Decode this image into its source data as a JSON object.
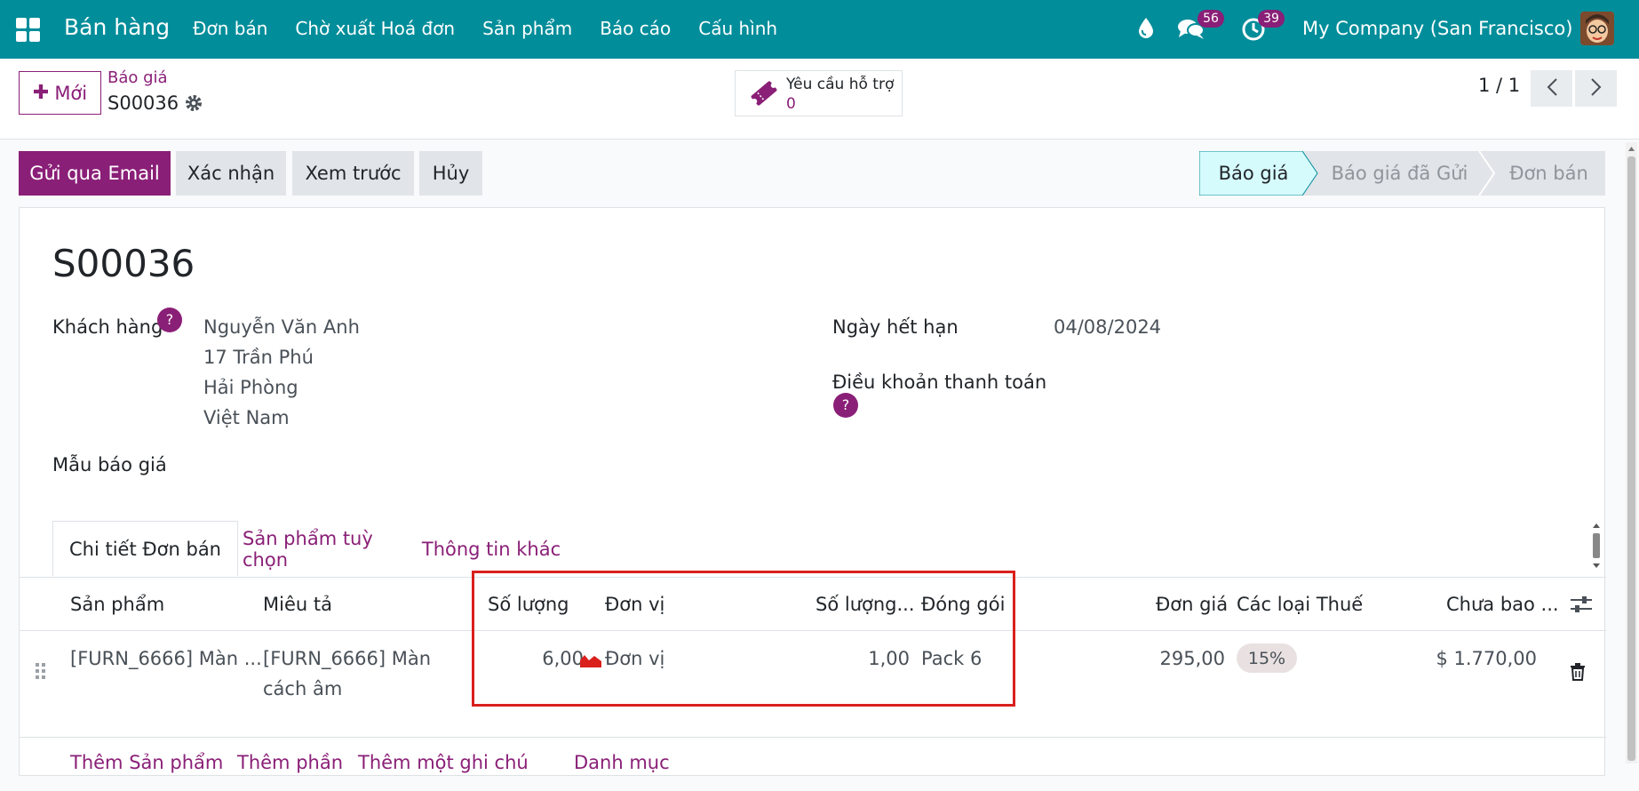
{
  "nav": {
    "app_name": "Bán hàng",
    "menu": [
      "Đơn bán",
      "Chờ xuất Hoá đơn",
      "Sản phẩm",
      "Báo cáo",
      "Cấu hình"
    ],
    "messages_count": "56",
    "activities_count": "39",
    "company": "My Company (San Francisco)"
  },
  "control": {
    "new_label": "Mới",
    "breadcrumb_parent": "Báo giá",
    "breadcrumb_current": "S00036",
    "support_label": "Yêu cầu hỗ trợ",
    "support_count": "0",
    "pager": "1 / 1"
  },
  "actions": {
    "send_email": "Gửi qua Email",
    "confirm": "Xác nhận",
    "preview": "Xem trước",
    "cancel": "Hủy"
  },
  "stages": {
    "items": [
      "Báo giá",
      "Báo giá đã Gửi",
      "Đơn bán"
    ],
    "active": "Báo giá"
  },
  "form": {
    "title": "S00036",
    "customer_label": "Khách hàng",
    "customer_lines": [
      "Nguyễn Văn Anh",
      "17 Trần Phú",
      "Hải Phòng",
      "Việt Nam"
    ],
    "expiry_label": "Ngày hết hạn",
    "expiry_value": "04/08/2024",
    "payment_terms_label": "Điều khoản thanh toán",
    "template_label": "Mẫu báo giá",
    "help_mark": "?"
  },
  "tabs": [
    "Chi tiết Đơn bán",
    "Sản phẩm tuỳ chọn",
    "Thông tin khác"
  ],
  "table": {
    "columns": [
      "Sản phẩm",
      "Miêu tả",
      "Số lượng",
      "Đơn vị",
      "Số lượng...",
      "Đóng gói",
      "Đơn giá",
      "Các loại Thuế",
      "Chưa bao ..."
    ],
    "rows": [
      {
        "product": "[FURN_6666] Màn ...",
        "description_line1": "[FURN_6666] Màn",
        "description_line2": "cách âm",
        "quantity": "6,00",
        "uom": "Đơn vị",
        "packaging_qty": "1,00",
        "packaging": "Pack 6",
        "unit_price": "295,00",
        "tax": "15%",
        "subtotal": "$ 1.770,00"
      }
    ],
    "add_links": [
      "Thêm Sản phẩm",
      "Thêm phần",
      "Thêm một ghi chú",
      "Danh mục"
    ]
  },
  "colors": {
    "navbar": "#018d9a",
    "primary": "#8a1f77",
    "active_stage": "#d6fbfd",
    "highlight_box": "#d9201c"
  }
}
